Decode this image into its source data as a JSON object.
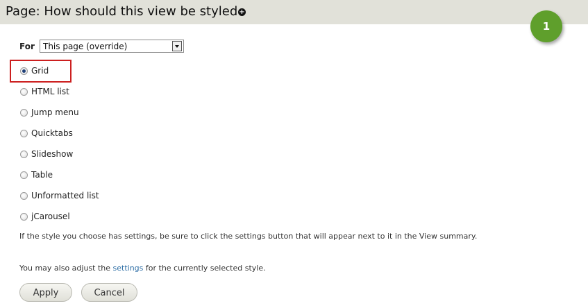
{
  "header": {
    "title": "Page: How should this view be styled",
    "title_icon": "plus-circle-icon"
  },
  "badge": {
    "number": "1",
    "color": "#5f9f2c"
  },
  "for_field": {
    "label": "For",
    "selected": "This page (override)"
  },
  "styles": {
    "selected": "Grid",
    "options": [
      {
        "label": "Grid",
        "checked": true
      },
      {
        "label": "HTML list",
        "checked": false
      },
      {
        "label": "Jump menu",
        "checked": false
      },
      {
        "label": "Quicktabs",
        "checked": false
      },
      {
        "label": "Slideshow",
        "checked": false
      },
      {
        "label": "Table",
        "checked": false
      },
      {
        "label": "Unformatted list",
        "checked": false
      },
      {
        "label": "jCarousel",
        "checked": false
      }
    ]
  },
  "help_text": "If the style you choose has settings, be sure to click the settings button that will appear next to it in the View summary.",
  "adjust": {
    "before": "You may also adjust the ",
    "link": "settings",
    "after": " for the currently selected style."
  },
  "buttons": {
    "apply": "Apply",
    "cancel": "Cancel"
  },
  "colors": {
    "highlight": "#cc1f1f",
    "link": "#2f6fa6",
    "titlebar": "#e1e1d9"
  }
}
